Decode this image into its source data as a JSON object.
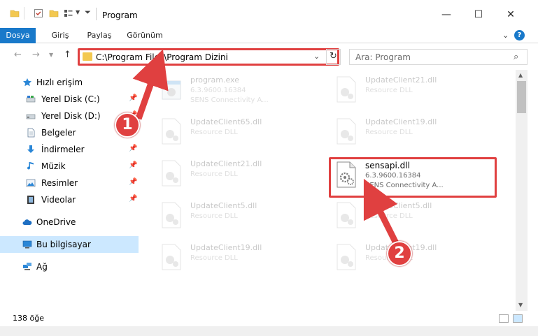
{
  "window": {
    "title": "Program",
    "minimize": "—",
    "maximize": "☐",
    "close": "✕"
  },
  "ribbon": {
    "tabs": [
      "Dosya",
      "Giriş",
      "Paylaş",
      "Görünüm"
    ],
    "help": "?"
  },
  "address": {
    "path": "C:\\Program Files\\Program Dizini",
    "search_placeholder": "Ara: Program"
  },
  "sidebar": {
    "items": [
      {
        "label": "Hızlı erişim",
        "icon": "star-icon"
      },
      {
        "label": "Yerel Disk (C:)",
        "icon": "drive-icon"
      },
      {
        "label": "Yerel Disk (D:)",
        "icon": "drive-icon"
      },
      {
        "label": "Belgeler",
        "icon": "document-icon"
      },
      {
        "label": "İndirmeler",
        "icon": "download-icon"
      },
      {
        "label": "Müzik",
        "icon": "music-icon"
      },
      {
        "label": "Resimler",
        "icon": "pictures-icon"
      },
      {
        "label": "Videolar",
        "icon": "video-icon"
      },
      {
        "label": "OneDrive",
        "icon": "cloud-icon"
      },
      {
        "label": "Bu bilgisayar",
        "icon": "computer-icon"
      },
      {
        "label": "Ağ",
        "icon": "network-icon"
      }
    ]
  },
  "files": [
    {
      "name": "program.exe",
      "line2": "6.3.9600.16384",
      "line3": "SENS Connectivity A..."
    },
    {
      "name": "UpdateClient21.dll",
      "line2": "Resource DLL",
      "line3": ""
    },
    {
      "name": "UpdateClient65.dll",
      "line2": "Resource DLL",
      "line3": ""
    },
    {
      "name": "UpdateClient19.dll",
      "line2": "Resource DLL",
      "line3": ""
    },
    {
      "name": "UpdateClient21.dll",
      "line2": "Resource DLL",
      "line3": ""
    },
    {
      "name": "sensapi.dll",
      "line2": "6.3.9600.16384",
      "line3": "SENS Connectivity A..."
    },
    {
      "name": "UpdateClient5.dll",
      "line2": "Resource DLL",
      "line3": ""
    },
    {
      "name": "UpdateClient5.dll",
      "line2": "Resource DLL",
      "line3": ""
    },
    {
      "name": "UpdateClient19.dll",
      "line2": "Resource DLL",
      "line3": ""
    },
    {
      "name": "UpdateClient19.dll",
      "line2": "Resource DLL",
      "line3": ""
    }
  ],
  "status": {
    "count": "138 öğe"
  },
  "annotations": {
    "step1": "1",
    "step2": "2",
    "color": "#e04040"
  }
}
